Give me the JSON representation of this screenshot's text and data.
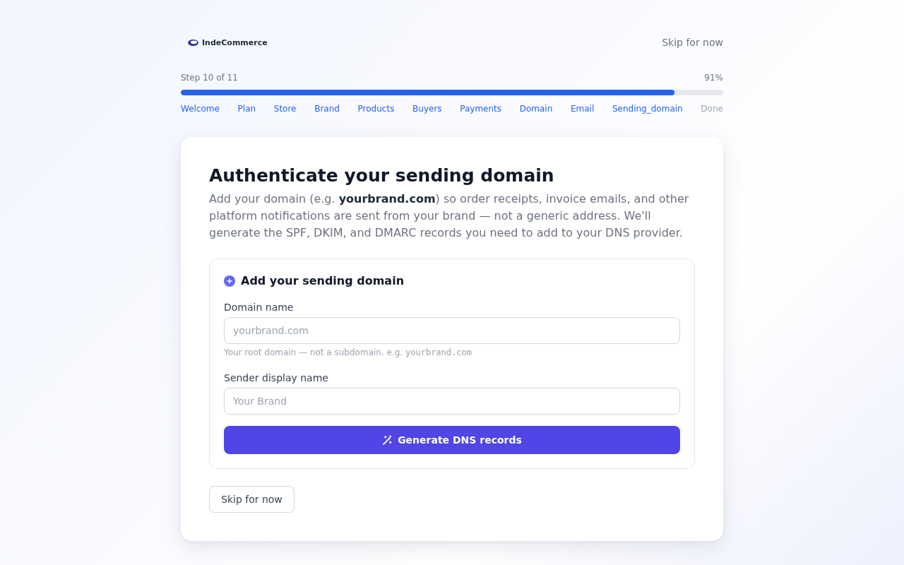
{
  "header": {
    "brand": "IndeCommerce",
    "skip_link": "Skip for now"
  },
  "progress": {
    "step_label": "Step 10 of 11",
    "percent": "91%",
    "level": 0.91,
    "steps": [
      {
        "label": "Welcome",
        "completed": true
      },
      {
        "label": "Plan",
        "completed": true
      },
      {
        "label": "Store",
        "completed": true
      },
      {
        "label": "Brand",
        "completed": true
      },
      {
        "label": "Products",
        "completed": true
      },
      {
        "label": "Buyers",
        "completed": true
      },
      {
        "label": "Payments",
        "completed": true
      },
      {
        "label": "Domain",
        "completed": true
      },
      {
        "label": "Email",
        "completed": true
      },
      {
        "label": "Sending_domain",
        "completed": true
      },
      {
        "label": "Done",
        "completed": false
      }
    ]
  },
  "card": {
    "title": "Authenticate your sending domain",
    "description": "Add your domain (e.g. **yourbrand.com**) so order receipts, invoice emails, and other platform notifications are sent from your brand — not a generic address. We'll generate the SPF, DKIM, and DMARC records you need to add to your DNS provider.",
    "section": {
      "title": "Add your sending domain",
      "fields": [
        {
          "label": "Domain name",
          "placeholder": "yourbrand.com",
          "hint": "Your root domain — not a subdomain. e.g.",
          "hint_example": "yourbrand.com"
        },
        {
          "label": "Sender display name",
          "placeholder": "Your Brand"
        }
      ],
      "submit_button": "Generate DNS records"
    },
    "skip_button": "Skip for now"
  }
}
